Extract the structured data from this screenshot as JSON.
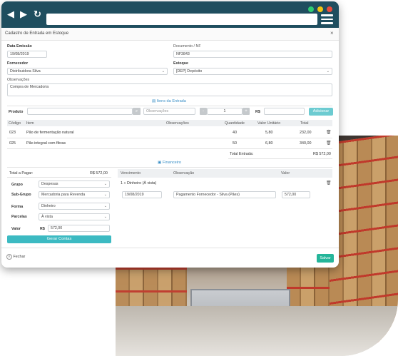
{
  "form": {
    "title": "Cadastro de Entrada em Estoque",
    "close": "×",
    "data_emissao_label": "Data Emissão",
    "data_emissao_value": "19/08/2019",
    "documento_label": "Documento / NF",
    "documento_value": "NF3843",
    "fornecedor_label": "Fornecedor",
    "fornecedor_value": "Distribuidora Silva",
    "estoque_label": "Estoque",
    "estoque_value": "[DEP] Depósito",
    "observacoes_label": "Observações",
    "observacoes_value": "Compra de Mercadoria"
  },
  "itens": {
    "section_title": "Itens da Entrada",
    "produto_label": "Produto",
    "observacoes_placeholder": "Observações",
    "quantidade_value": "1",
    "minus": "-",
    "plus": "+",
    "currency": "R$",
    "adicionar_label": "Adicionar",
    "columns": [
      "Código",
      "Item",
      "Observações",
      "Quantidade",
      "Valor Unitário",
      "Total"
    ],
    "rows": [
      {
        "codigo": "023",
        "item": "Pão de fermentação natural",
        "obs": "",
        "quantidade": "40",
        "valor": "5,80",
        "total": "232,00"
      },
      {
        "codigo": "025",
        "item": "Pão integral com fibras",
        "obs": "",
        "quantidade": "50",
        "valor": "6,80",
        "total": "340,00"
      }
    ],
    "total_label": "Total Entrada:",
    "total_value": "R$ 572,00"
  },
  "financeiro": {
    "section_title": "Financeiro",
    "total_pagar_label": "Total a Pagar:",
    "total_pagar_value": "R$ 572,00",
    "grupo_label": "Grupo",
    "grupo_value": "Despesas",
    "subgrupo_label": "Sub-Grupo",
    "subgrupo_value": "Mercadoria para Revenda",
    "forma_label": "Forma",
    "forma_value": "Dinheiro",
    "parcelas_label": "Parcelas",
    "parcelas_value": "À vista",
    "valor_label": "Valor",
    "valor_currency": "R$",
    "valor_value": "572,00",
    "gerar_contas_label": "Gerar Contas",
    "columns": [
      "Vencimento",
      "Observação",
      "Valor"
    ],
    "parcela_title": "1 » Dinheiro (À vista)",
    "parcela_vencimento": "19/08/2019",
    "parcela_observacao": "Pagamento Fornecedor - Silva (Pães)",
    "parcela_valor": "572,00"
  },
  "footer": {
    "fechar_label": "Fechar",
    "salvar_label": "Salvar"
  },
  "colors": {
    "chrome": "#1f4e5f",
    "dot_green": "#2ecc71",
    "dot_yellow": "#f1c40f",
    "dot_red": "#e74c3c",
    "accent": "#3cbac2",
    "save": "#24b59a"
  }
}
